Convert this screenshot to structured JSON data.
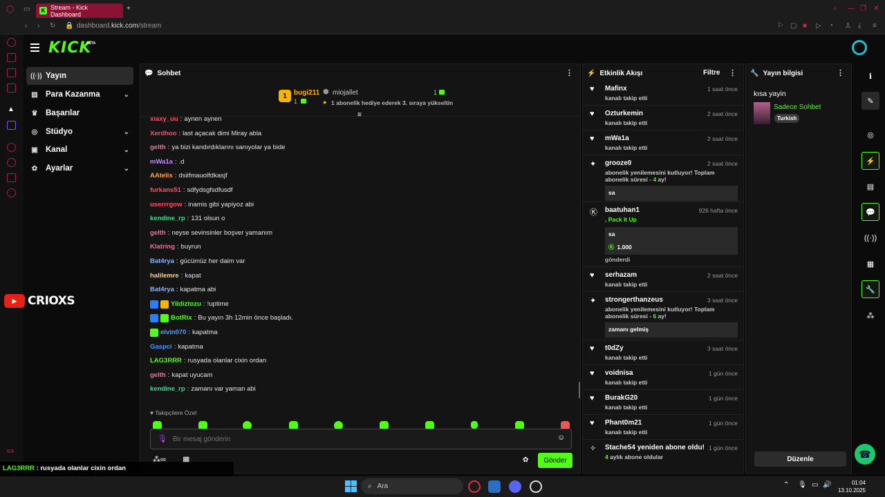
{
  "browser": {
    "tab_title": "Stream - Kick Dashboard",
    "url_prefix": "dashboard.",
    "url_domain": "kick.com",
    "url_path": "/stream"
  },
  "app": {
    "logo": "KICK",
    "beta": "BETA"
  },
  "nav": {
    "items": [
      {
        "label": "Yayın",
        "icon": "broadcast-icon",
        "active": true
      },
      {
        "label": "Para Kazanma",
        "icon": "money-icon",
        "expandable": true
      },
      {
        "label": "Başarılar",
        "icon": "trophy-icon"
      },
      {
        "label": "Stüdyo",
        "icon": "studio-icon",
        "expandable": true
      },
      {
        "label": "Kanal",
        "icon": "channel-icon",
        "expandable": true
      },
      {
        "label": "Ayarlar",
        "icon": "settings-icon",
        "expandable": true
      }
    ]
  },
  "chat": {
    "title": "Sohbet",
    "pinned": {
      "gifter": "bugi211",
      "gifter_count": "1",
      "rank": "1",
      "recipient": "miojallet",
      "recipient_count": "1",
      "message": "1 abonelik hediye ederek 3. sıraya yükseltin"
    },
    "messages": [
      {
        "user": "xiaxy_uu",
        "text": "aynen aynen",
        "color": "#ff4d6d"
      },
      {
        "user": "Xerdhoo",
        "text": "last açacak dimi Miray abla",
        "color": "#ff4d6d"
      },
      {
        "user": "gelth",
        "text": "ya bizi kandırdıklarını sanıyolar ya bide",
        "color": "#ff6b9a"
      },
      {
        "user": "mWa1a",
        "text": ".d",
        "color": "#c48bff"
      },
      {
        "user": "AAtelis",
        "text": "dsiifmauolfdkasjf",
        "color": "#ffa53a"
      },
      {
        "user": "furkans51",
        "text": "sdfydsgfsdfusdf",
        "color": "#ff4d6d"
      },
      {
        "user": "userrrgow",
        "text": "inamis gibi yapiyoz abi",
        "color": "#ff4d6d"
      },
      {
        "user": "kendine_rp",
        "text": "131 olsun o",
        "color": "#3ddc97"
      },
      {
        "user": "gelth",
        "text": "neyse sevinsinler boşver yamanım",
        "color": "#ff6b9a"
      },
      {
        "user": "Klatring",
        "text": "buyrun",
        "color": "#ff6b9a"
      },
      {
        "user": "Bat4rya",
        "text": "gücümüz her daim var",
        "color": "#8ab4ff"
      },
      {
        "user": "halilemre",
        "text": "kapat",
        "color": "#ffd27a"
      },
      {
        "user": "Bat4rya",
        "text": "kapatma abi",
        "color": "#8ab4ff"
      },
      {
        "user": "Yildiztozu",
        "text": "!uptime",
        "color": "#53fc18",
        "badges": [
          "#2a7fff",
          "#f7b500"
        ]
      },
      {
        "user": "BotRix",
        "text": "Bu yayın 3h 12min önce başladı.",
        "color": "#53fc18",
        "badges": [
          "#2a7fff",
          "#53fc18"
        ]
      },
      {
        "user": "elvin070",
        "text": "kapatma",
        "color": "#4aa3ff",
        "badges": [
          "#53fc18"
        ]
      },
      {
        "user": "Gaspci",
        "text": "kapatma",
        "color": "#4a9aff"
      },
      {
        "user": "LAG3RRR",
        "text": "rusyada olanlar cixin ordan",
        "color": "#53fc18"
      },
      {
        "user": "gelth",
        "text": "kapat uyucam",
        "color": "#ff6b9a"
      },
      {
        "user": "kendine_rp",
        "text": "zamanı var yaman abi",
        "color": "#3ddc97"
      }
    ],
    "followers_only": "Takipçilere Özel",
    "input_placeholder": "Bir mesaj gönderin",
    "send_label": "Gönder"
  },
  "activity": {
    "title": "Etkinlik Akışı",
    "filter_label": "Filtre",
    "events": [
      {
        "name": "Mafinx",
        "desc": "kanalı takip etti",
        "time": "1 saat önce",
        "icon": "heart-icon"
      },
      {
        "name": "Ozturkemin",
        "desc": "kanalı takip etti",
        "time": "2 saat önce",
        "icon": "heart-icon"
      },
      {
        "name": "mWa1a",
        "desc": "kanalı takip etti",
        "time": "2 saat önce",
        "icon": "heart-icon"
      },
      {
        "name": "grooze0",
        "desc": "abonelik yenilemesini kutluyor! Toplam abonelik süresi - ",
        "months": "4",
        "suffix": " ay!",
        "time": "2 saat önce",
        "icon": "star-icon",
        "quote": "sa"
      },
      {
        "name": "baatuhan1",
        "desc": ", ",
        "pack": "Pack It Up",
        "time": "926 hafta önce",
        "icon": "kick-coin-icon",
        "quote": "sa",
        "amount": "1.000",
        "sent": "gönderdi"
      },
      {
        "name": "serhazam",
        "desc": "kanalı takip etti",
        "time": "2 saat önce",
        "icon": "heart-icon"
      },
      {
        "name": "strongerthanzeus",
        "desc": "abonelik yenilemesini kutluyor! Toplam abonelik süresi - ",
        "months": "6",
        "suffix": " ay!",
        "time": "3 saat önce",
        "icon": "star-icon",
        "quote": "zamanı gelmiş"
      },
      {
        "name": "t0dZy",
        "desc": "kanalı takip etti",
        "time": "3 saat önce",
        "icon": "heart-icon"
      },
      {
        "name": "voidnisa",
        "desc": "kanalı takip etti",
        "time": "1 gün önce",
        "icon": "heart-icon"
      },
      {
        "name": "BurakG20",
        "desc": "kanalı takip etti",
        "time": "1 gün önce",
        "icon": "heart-icon"
      },
      {
        "name": "Phant0m21",
        "desc": "kanalı takip etti",
        "time": "1 gün önce",
        "icon": "heart-icon"
      },
      {
        "name": "Stache54 yeniden abone oldu!",
        "desc": "aylık abone oldular",
        "months": "4",
        "time": "1 gün önce",
        "icon": "sparkle-icon"
      }
    ]
  },
  "stream_info": {
    "title": "Yayın bilgisi",
    "stream_title": "kısa yayin",
    "category": "Sadece Sohbet",
    "language": "Turkish",
    "edit_label": "Düzenle"
  },
  "overlay": {
    "channel": "CRIOXS",
    "chat": [
      {
        "user": "LAG3RRR",
        "text": " : rusyada olanlar cixin ordan",
        "color": "#53fc18"
      },
      {
        "user": "gelth",
        "text": " : kapat uyucam",
        "color": "#ff4d6d"
      },
      {
        "user": "kendine_rp",
        "text": " : zamanı var yaman abi",
        "color": "#3ddc97"
      }
    ],
    "corner_label": "GX"
  },
  "taskbar": {
    "search": "Ara",
    "time": "01:04",
    "date": "13.10.2025"
  },
  "colors": {
    "accent": "#53fc18",
    "opera": "#b01a45",
    "panel": "#141414"
  }
}
